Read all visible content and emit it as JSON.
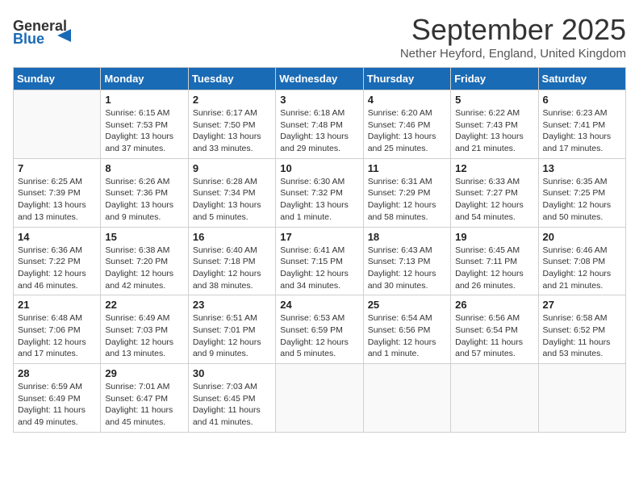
{
  "header": {
    "logo_general": "General",
    "logo_blue": "Blue",
    "month": "September 2025",
    "location": "Nether Heyford, England, United Kingdom"
  },
  "days_of_week": [
    "Sunday",
    "Monday",
    "Tuesday",
    "Wednesday",
    "Thursday",
    "Friday",
    "Saturday"
  ],
  "weeks": [
    [
      {
        "day": "",
        "content": ""
      },
      {
        "day": "1",
        "content": "Sunrise: 6:15 AM\nSunset: 7:53 PM\nDaylight: 13 hours\nand 37 minutes."
      },
      {
        "day": "2",
        "content": "Sunrise: 6:17 AM\nSunset: 7:50 PM\nDaylight: 13 hours\nand 33 minutes."
      },
      {
        "day": "3",
        "content": "Sunrise: 6:18 AM\nSunset: 7:48 PM\nDaylight: 13 hours\nand 29 minutes."
      },
      {
        "day": "4",
        "content": "Sunrise: 6:20 AM\nSunset: 7:46 PM\nDaylight: 13 hours\nand 25 minutes."
      },
      {
        "day": "5",
        "content": "Sunrise: 6:22 AM\nSunset: 7:43 PM\nDaylight: 13 hours\nand 21 minutes."
      },
      {
        "day": "6",
        "content": "Sunrise: 6:23 AM\nSunset: 7:41 PM\nDaylight: 13 hours\nand 17 minutes."
      }
    ],
    [
      {
        "day": "7",
        "content": "Sunrise: 6:25 AM\nSunset: 7:39 PM\nDaylight: 13 hours\nand 13 minutes."
      },
      {
        "day": "8",
        "content": "Sunrise: 6:26 AM\nSunset: 7:36 PM\nDaylight: 13 hours\nand 9 minutes."
      },
      {
        "day": "9",
        "content": "Sunrise: 6:28 AM\nSunset: 7:34 PM\nDaylight: 13 hours\nand 5 minutes."
      },
      {
        "day": "10",
        "content": "Sunrise: 6:30 AM\nSunset: 7:32 PM\nDaylight: 13 hours\nand 1 minute."
      },
      {
        "day": "11",
        "content": "Sunrise: 6:31 AM\nSunset: 7:29 PM\nDaylight: 12 hours\nand 58 minutes."
      },
      {
        "day": "12",
        "content": "Sunrise: 6:33 AM\nSunset: 7:27 PM\nDaylight: 12 hours\nand 54 minutes."
      },
      {
        "day": "13",
        "content": "Sunrise: 6:35 AM\nSunset: 7:25 PM\nDaylight: 12 hours\nand 50 minutes."
      }
    ],
    [
      {
        "day": "14",
        "content": "Sunrise: 6:36 AM\nSunset: 7:22 PM\nDaylight: 12 hours\nand 46 minutes."
      },
      {
        "day": "15",
        "content": "Sunrise: 6:38 AM\nSunset: 7:20 PM\nDaylight: 12 hours\nand 42 minutes."
      },
      {
        "day": "16",
        "content": "Sunrise: 6:40 AM\nSunset: 7:18 PM\nDaylight: 12 hours\nand 38 minutes."
      },
      {
        "day": "17",
        "content": "Sunrise: 6:41 AM\nSunset: 7:15 PM\nDaylight: 12 hours\nand 34 minutes."
      },
      {
        "day": "18",
        "content": "Sunrise: 6:43 AM\nSunset: 7:13 PM\nDaylight: 12 hours\nand 30 minutes."
      },
      {
        "day": "19",
        "content": "Sunrise: 6:45 AM\nSunset: 7:11 PM\nDaylight: 12 hours\nand 26 minutes."
      },
      {
        "day": "20",
        "content": "Sunrise: 6:46 AM\nSunset: 7:08 PM\nDaylight: 12 hours\nand 21 minutes."
      }
    ],
    [
      {
        "day": "21",
        "content": "Sunrise: 6:48 AM\nSunset: 7:06 PM\nDaylight: 12 hours\nand 17 minutes."
      },
      {
        "day": "22",
        "content": "Sunrise: 6:49 AM\nSunset: 7:03 PM\nDaylight: 12 hours\nand 13 minutes."
      },
      {
        "day": "23",
        "content": "Sunrise: 6:51 AM\nSunset: 7:01 PM\nDaylight: 12 hours\nand 9 minutes."
      },
      {
        "day": "24",
        "content": "Sunrise: 6:53 AM\nSunset: 6:59 PM\nDaylight: 12 hours\nand 5 minutes."
      },
      {
        "day": "25",
        "content": "Sunrise: 6:54 AM\nSunset: 6:56 PM\nDaylight: 12 hours\nand 1 minute."
      },
      {
        "day": "26",
        "content": "Sunrise: 6:56 AM\nSunset: 6:54 PM\nDaylight: 11 hours\nand 57 minutes."
      },
      {
        "day": "27",
        "content": "Sunrise: 6:58 AM\nSunset: 6:52 PM\nDaylight: 11 hours\nand 53 minutes."
      }
    ],
    [
      {
        "day": "28",
        "content": "Sunrise: 6:59 AM\nSunset: 6:49 PM\nDaylight: 11 hours\nand 49 minutes."
      },
      {
        "day": "29",
        "content": "Sunrise: 7:01 AM\nSunset: 6:47 PM\nDaylight: 11 hours\nand 45 minutes."
      },
      {
        "day": "30",
        "content": "Sunrise: 7:03 AM\nSunset: 6:45 PM\nDaylight: 11 hours\nand 41 minutes."
      },
      {
        "day": "",
        "content": ""
      },
      {
        "day": "",
        "content": ""
      },
      {
        "day": "",
        "content": ""
      },
      {
        "day": "",
        "content": ""
      }
    ]
  ]
}
